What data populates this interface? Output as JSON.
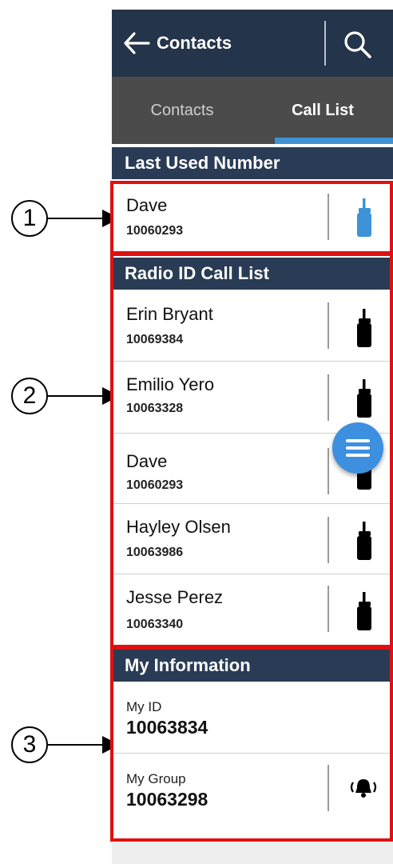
{
  "appbar": {
    "title": "Contacts"
  },
  "tabs": [
    {
      "label": "Contacts"
    },
    {
      "label": "Call List"
    }
  ],
  "last_used": {
    "header": "Last Used Number",
    "entry": {
      "name": "Dave",
      "number": "10060293",
      "icon": "radio-icon-blue"
    }
  },
  "radio_list": {
    "header": "Radio ID Call List",
    "items": [
      {
        "name": "Erin Bryant",
        "number": "10069384",
        "icon": "radio-icon"
      },
      {
        "name": "Emilio Yero",
        "number": "10063328",
        "icon": "radio-icon"
      },
      {
        "name": "Dave",
        "number": "10060293",
        "icon": "radio-icon"
      },
      {
        "name": "Hayley Olsen",
        "number": "10063986",
        "icon": "radio-icon"
      },
      {
        "name": "Jesse Perez",
        "number": "10063340",
        "icon": "radio-icon"
      }
    ]
  },
  "my_info": {
    "header": "My Information",
    "my_id": {
      "label": "My ID",
      "value": "10063834"
    },
    "my_group": {
      "label": "My Group",
      "value": "10063298",
      "icon": "bell-alert-icon"
    }
  },
  "callouts": [
    {
      "label": "1"
    },
    {
      "label": "2"
    },
    {
      "label": "3"
    }
  ],
  "colors": {
    "appbar": "#24344a",
    "section_header": "#2a3c55",
    "tab_bar": "#4b4b4b",
    "accent": "#3d93d6",
    "highlight_box": "#e01010"
  }
}
